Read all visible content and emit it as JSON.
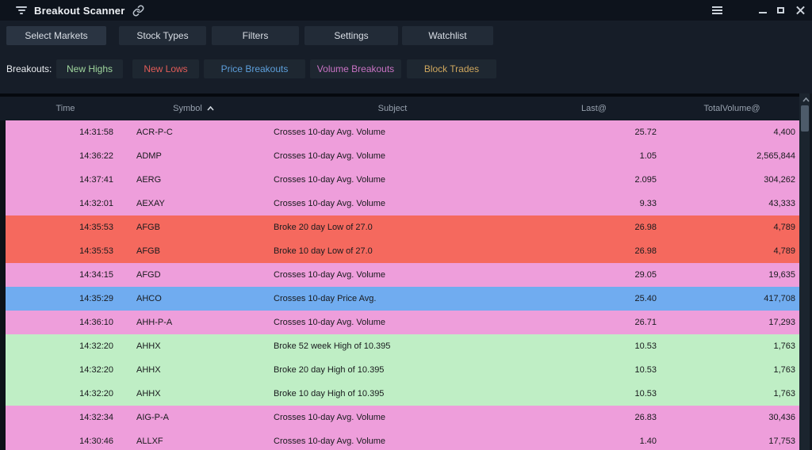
{
  "window": {
    "title": "Breakout Scanner"
  },
  "icons": {
    "titlebar": [
      "filter-funnel-icon",
      "link-icon"
    ],
    "window_controls": [
      "menu-icon",
      "minimize-icon",
      "maximize-icon",
      "close-icon"
    ],
    "table": [
      "sort-asc-icon",
      "scroll-up-icon"
    ]
  },
  "toolbar": {
    "buttons": [
      "Select Markets",
      "Stock Types",
      "Filters",
      "Settings",
      "Watchlist"
    ]
  },
  "filters": {
    "label": "Breakouts:",
    "buttons": [
      {
        "label": "New Highs",
        "color": "#9fd69d"
      },
      {
        "label": "New Lows",
        "color": "#e25c58"
      },
      {
        "label": "Price Breakouts",
        "color": "#5d9fdb"
      },
      {
        "label": "Volume Breakouts",
        "color": "#c973c4"
      },
      {
        "label": "Block Trades",
        "color": "#cfa75e"
      }
    ]
  },
  "table": {
    "columns": [
      {
        "key": "time",
        "label": "Time"
      },
      {
        "key": "symbol",
        "label": "Symbol",
        "sort": "asc"
      },
      {
        "key": "subject",
        "label": "Subject"
      },
      {
        "key": "last",
        "label": "Last@"
      },
      {
        "key": "volume",
        "label": "TotalVolume@"
      }
    ],
    "row_colors": {
      "volume": "#ee9edb",
      "low": "#f5695e",
      "price": "#70acf0",
      "high": "#bfeec5"
    },
    "rows": [
      {
        "time": "14:31:58",
        "symbol": "ACR-P-C",
        "subject": "Crosses 10-day Avg. Volume",
        "last": "25.72",
        "volume": "4,400",
        "type": "volume"
      },
      {
        "time": "14:36:22",
        "symbol": "ADMP",
        "subject": "Crosses 10-day Avg. Volume",
        "last": "1.05",
        "volume": "2,565,844",
        "type": "volume"
      },
      {
        "time": "14:37:41",
        "symbol": "AERG",
        "subject": "Crosses 10-day Avg. Volume",
        "last": "2.095",
        "volume": "304,262",
        "type": "volume"
      },
      {
        "time": "14:32:01",
        "symbol": "AEXAY",
        "subject": "Crosses 10-day Avg. Volume",
        "last": "9.33",
        "volume": "43,333",
        "type": "volume"
      },
      {
        "time": "14:35:53",
        "symbol": "AFGB",
        "subject": "Broke 20 day Low of 27.0",
        "last": "26.98",
        "volume": "4,789",
        "type": "low"
      },
      {
        "time": "14:35:53",
        "symbol": "AFGB",
        "subject": "Broke 10 day Low of 27.0",
        "last": "26.98",
        "volume": "4,789",
        "type": "low"
      },
      {
        "time": "14:34:15",
        "symbol": "AFGD",
        "subject": "Crosses 10-day Avg. Volume",
        "last": "29.05",
        "volume": "19,635",
        "type": "volume"
      },
      {
        "time": "14:35:29",
        "symbol": "AHCO",
        "subject": "Crosses 10-day Price Avg.",
        "last": "25.40",
        "volume": "417,708",
        "type": "price"
      },
      {
        "time": "14:36:10",
        "symbol": "AHH-P-A",
        "subject": "Crosses 10-day Avg. Volume",
        "last": "26.71",
        "volume": "17,293",
        "type": "volume"
      },
      {
        "time": "14:32:20",
        "symbol": "AHHX",
        "subject": "Broke 52 week High of 10.395",
        "last": "10.53",
        "volume": "1,763",
        "type": "high"
      },
      {
        "time": "14:32:20",
        "symbol": "AHHX",
        "subject": "Broke 20 day High of 10.395",
        "last": "10.53",
        "volume": "1,763",
        "type": "high"
      },
      {
        "time": "14:32:20",
        "symbol": "AHHX",
        "subject": "Broke 10 day High of 10.395",
        "last": "10.53",
        "volume": "1,763",
        "type": "high"
      },
      {
        "time": "14:32:34",
        "symbol": "AIG-P-A",
        "subject": "Crosses 10-day Avg. Volume",
        "last": "26.83",
        "volume": "30,436",
        "type": "volume"
      },
      {
        "time": "14:30:46",
        "symbol": "ALLXF",
        "subject": "Crosses 10-day Avg. Volume",
        "last": "1.40",
        "volume": "17,753",
        "type": "volume"
      }
    ]
  },
  "colors": {
    "titlebar_bg": "#0d131c",
    "page_bg": "#161d28",
    "button_bg": "#222b37",
    "header_bg": "#141b26",
    "scrollbar_thumb": "#4d5b6a"
  }
}
